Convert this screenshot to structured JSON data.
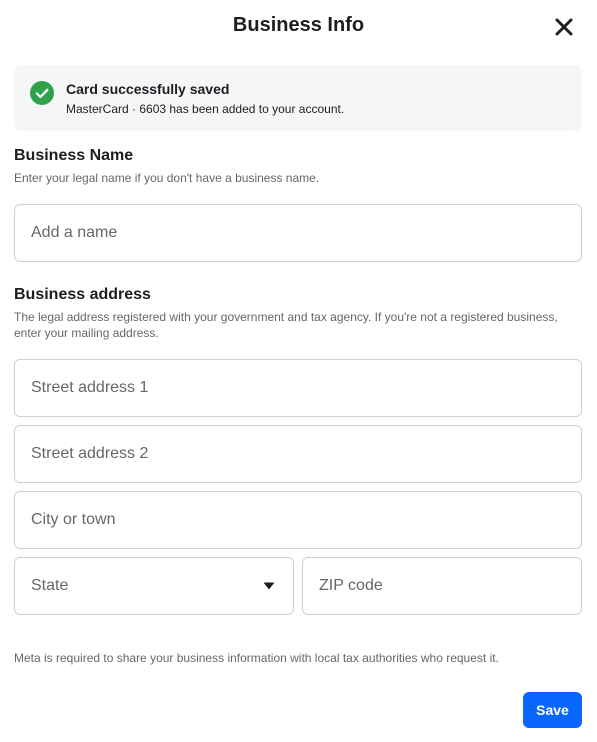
{
  "dialog": {
    "title": "Business Info",
    "close_icon": "close-icon"
  },
  "banner": {
    "icon": "check-circle-icon",
    "icon_color": "#31a24c",
    "title": "Card successfully saved",
    "message": "MasterCard · 6603 has been added to your account."
  },
  "business_name": {
    "heading": "Business Name",
    "description": "Enter your legal name if you don't have a business name.",
    "name_field": {
      "placeholder": "Add a name",
      "value": ""
    }
  },
  "business_address": {
    "heading": "Business address",
    "description": "The legal address registered with your government and tax agency. If you're not a registered business, enter your mailing address.",
    "street1": {
      "placeholder": "Street address 1",
      "value": ""
    },
    "street2": {
      "placeholder": "Street address 2",
      "value": ""
    },
    "city": {
      "placeholder": "City or town",
      "value": ""
    },
    "state": {
      "label": "State",
      "icon": "caret-down-icon"
    },
    "zip": {
      "placeholder": "ZIP code",
      "value": ""
    }
  },
  "footer": {
    "note": "Meta is required to share your business information with local tax authorities who request it.",
    "save_label": "Save",
    "accent_color": "#0866ff"
  }
}
